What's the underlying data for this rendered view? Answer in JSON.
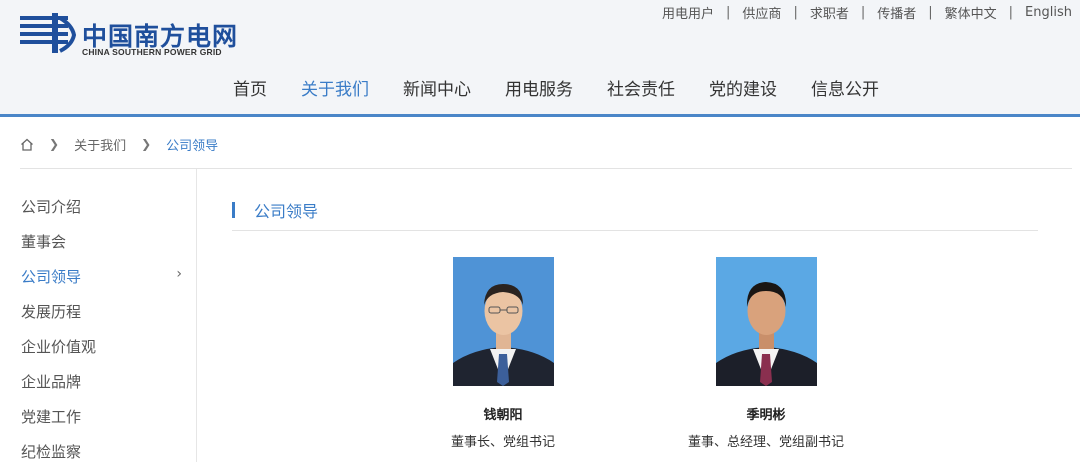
{
  "header": {
    "logo_cn": "中国南方电网",
    "logo_en": "CHINA SOUTHERN POWER GRID",
    "top_links": [
      "用电用户",
      "供应商",
      "求职者",
      "传播者",
      "繁体中文",
      "English"
    ],
    "nav": [
      "首页",
      "关于我们",
      "新闻中心",
      "用电服务",
      "社会责任",
      "党的建设",
      "信息公开"
    ],
    "nav_active": "关于我们"
  },
  "breadcrumb": {
    "icon": "home-icon",
    "items": [
      "关于我们",
      "公司领导"
    ]
  },
  "sidebar": {
    "items": [
      "公司介绍",
      "董事会",
      "公司领导",
      "发展历程",
      "企业价值观",
      "企业品牌",
      "党建工作",
      "纪检监察"
    ],
    "active": "公司领导"
  },
  "section": {
    "title": "公司领导"
  },
  "leaders": [
    {
      "name": "钱朝阳",
      "title": "董事长、党组书记",
      "bg": "#4f93d6",
      "tie": "#3c5f9a"
    },
    {
      "name": "季明彬",
      "title": "董事、总经理、党组副书记",
      "bg": "#5ba8e4",
      "tie": "#8a2f4f"
    }
  ],
  "colors": {
    "accent": "#3a7cc7",
    "brand": "#1f4f9c"
  }
}
